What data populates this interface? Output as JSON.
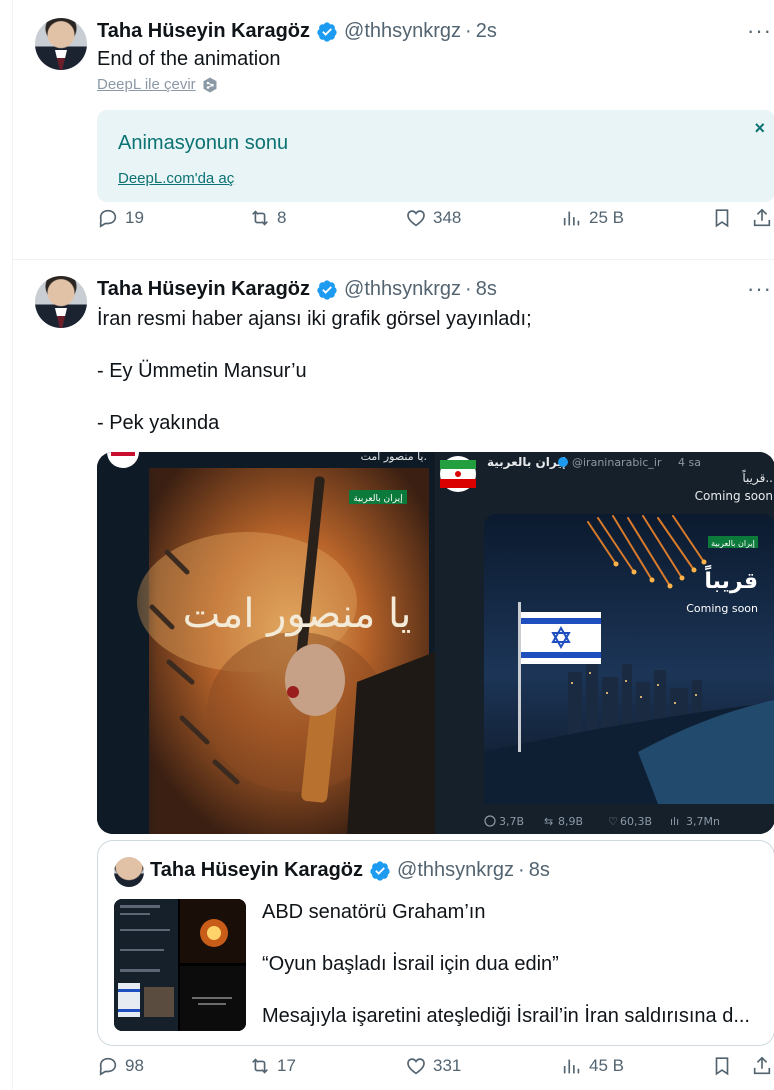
{
  "tweets": [
    {
      "name": "Taha Hüseyin Karagöz",
      "handle": "@thhsynkrgz",
      "dot": "·",
      "time": "2s",
      "more": "···",
      "text": "End of the animation",
      "translate_link": "DeepL ile çevir",
      "translation": {
        "text": "Animasyonun sonu",
        "link": "DeepL.com'da aç",
        "close": "×"
      },
      "actions": {
        "replies": "19",
        "reposts": "8",
        "likes": "348",
        "views": "25 B"
      }
    },
    {
      "name": "Taha Hüseyin Karagöz",
      "handle": "@thhsynkrgz",
      "dot": "·",
      "time": "8s",
      "more": "···",
      "lines": [
        "İran resmi haber ajansı iki grafik görsel yayınladı;",
        "- Ey Ümmetin Mansur’u",
        "- Pek yakında"
      ],
      "media": {
        "left_caption": "يا منصور امت.",
        "left_art_text": "يا منصور امت",
        "left_badge": "إيران بالعربية",
        "right_name": "إيران بالعربية",
        "right_handle": "@iraninarabic_ir",
        "right_time": "4 sa",
        "right_text_ar": "قريباً..",
        "right_text_en": "Coming soon",
        "right_art_ar": "قريباً",
        "right_art_en": "Coming soon",
        "right_badge": "إيران بالعربية",
        "right_stats": {
          "replies": "3,7B",
          "reposts": "8,9B",
          "likes": "60,3B",
          "views": "3,7Mn"
        }
      },
      "quote": {
        "name": "Taha Hüseyin Karagöz",
        "handle": "@thhsynkrgz",
        "dot": "·",
        "time": "8s",
        "lines": [
          "ABD senatörü Graham’ın",
          "“Oyun başladı İsrail için dua edin”",
          "Mesajıyla işaretini ateşlediği İsrail’in İran saldırısına d..."
        ]
      },
      "actions": {
        "replies": "98",
        "reposts": "17",
        "likes": "331",
        "views": "45 B"
      }
    }
  ],
  "colors": {
    "accent": "#1d9bf0",
    "muted": "#536471",
    "translation_bg": "#e8f4f5",
    "translation_text": "#0d7273"
  }
}
